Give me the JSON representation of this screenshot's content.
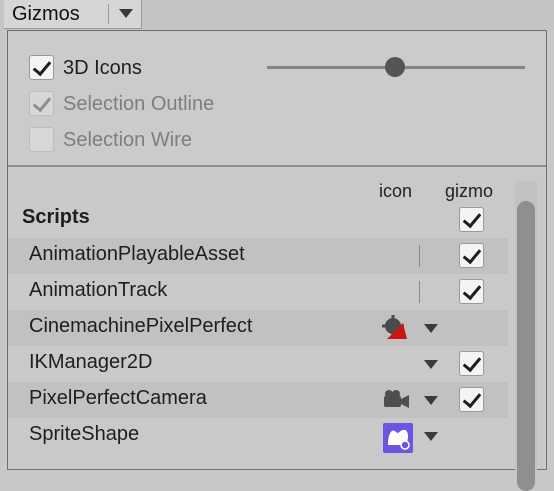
{
  "toolbar": {
    "label": "Gizmos"
  },
  "options": {
    "icons3d": {
      "label": "3D Icons",
      "checked": true,
      "enabled": true
    },
    "selection_outline": {
      "label": "Selection Outline",
      "checked": true,
      "enabled": false
    },
    "selection_wire": {
      "label": "Selection Wire",
      "checked": false,
      "enabled": false
    },
    "icon_size_slider": {
      "value": 0.52
    }
  },
  "columns": {
    "icon": "icon",
    "gizmo": "gizmo"
  },
  "section": {
    "title": "Scripts"
  },
  "rows": [
    {
      "label": "AnimationPlayableAsset",
      "icon": "none",
      "has_dropdown": false,
      "gizmo_checked": true
    },
    {
      "label": "AnimationTrack",
      "icon": "none",
      "has_dropdown": false,
      "gizmo_checked": true
    },
    {
      "label": "CinemachinePixelPerfect",
      "icon": "camera-red-icon",
      "has_dropdown": true,
      "gizmo_checked": null
    },
    {
      "label": "IKManager2D",
      "icon": "none",
      "has_dropdown": true,
      "gizmo_checked": true
    },
    {
      "label": "PixelPerfectCamera",
      "icon": "camera-gray-icon",
      "has_dropdown": true,
      "gizmo_checked": true
    },
    {
      "label": "SpriteShape",
      "icon": "sprite-shape-icon",
      "has_dropdown": true,
      "gizmo_checked": null
    }
  ],
  "colors": {
    "sprite_shape_icon": "#6a56e0",
    "camera_red": "#cc1616"
  }
}
